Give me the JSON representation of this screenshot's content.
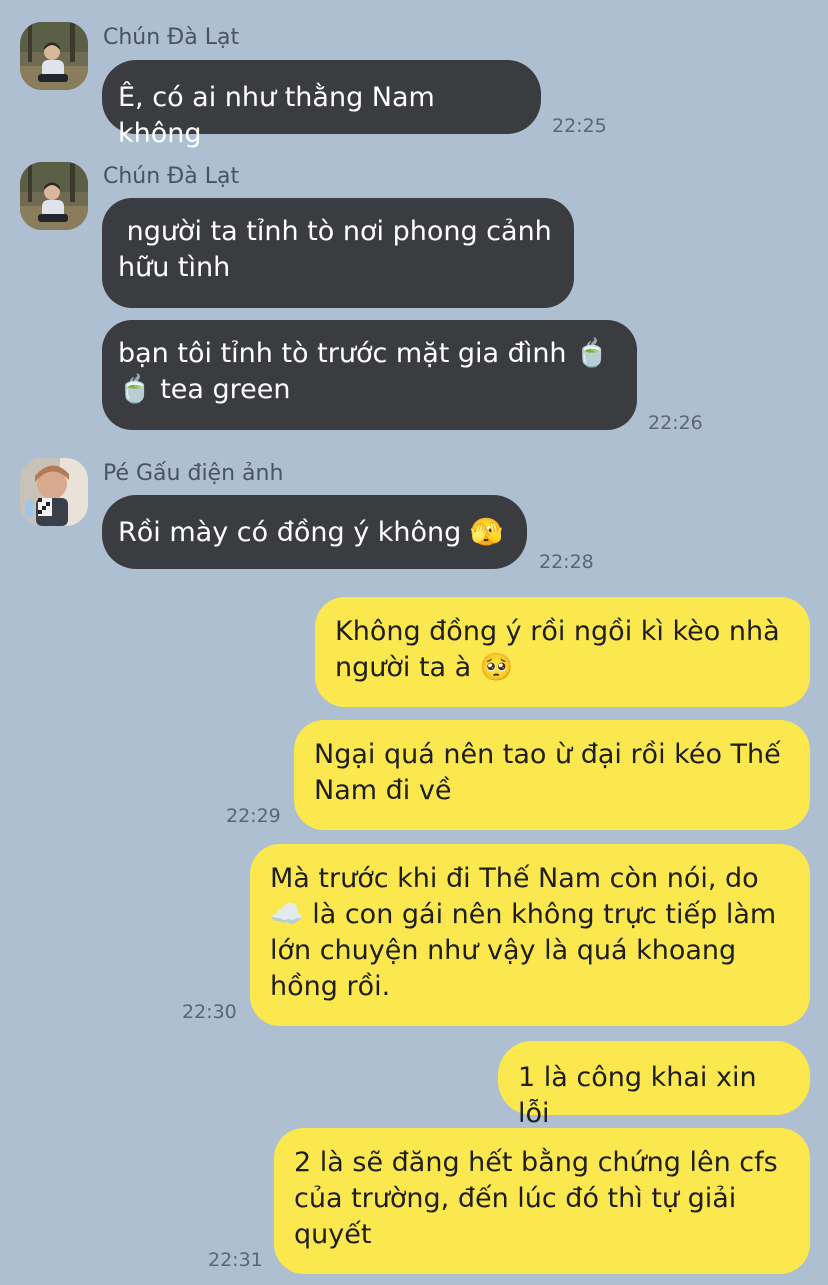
{
  "chat": {
    "background_color": "#aebfd1",
    "incoming_bubble_color": "#3b3c3f",
    "outgoing_bubble_color": "#fbe84e",
    "senders": {
      "chun": "Chún Đà Lạt",
      "pe_gau": "Pé Gấu điện ảnh"
    },
    "messages": [
      {
        "from": "Chún Đà Lạt",
        "text": "Ê, có ai như thằng Nam không",
        "time": "22:25"
      },
      {
        "from": "Chún Đà Lạt",
        "text": " người ta tỉnh tò nơi phong cảnh\nhữu tình"
      },
      {
        "from": "Chún Đà Lạt",
        "text": "bạn tôi tỉnh tò trước mặt gia đình 🍵\n🍵 tea green",
        "time": "22:26"
      },
      {
        "from": "Pé Gấu điện ảnh",
        "text": "Rồi mày có đồng ý không 🫣",
        "time": "22:28"
      },
      {
        "from": "me",
        "text": "Không đồng ý rồi ngồi kì kèo nhà\nngười ta à 🥺"
      },
      {
        "from": "me",
        "text": "Ngại quá nên tao ừ đại rồi kéo Thế\nNam đi về",
        "time": "22:29"
      },
      {
        "from": "me",
        "text": "Mà trước khi đi Thế Nam còn nói, do\n☁️ là con gái nên không trực tiếp làm\nlớn chuyện như vậy là quá khoang\nhồng rồi.",
        "time": "22:30"
      },
      {
        "from": "me",
        "text": "1 là công khai xin lỗi"
      },
      {
        "from": "me",
        "text": "2 là sẽ đăng hết bằng chứng lên cfs\ncủa trường, đến lúc đó thì tự giải\nquyết",
        "time": "22:31"
      }
    ]
  }
}
